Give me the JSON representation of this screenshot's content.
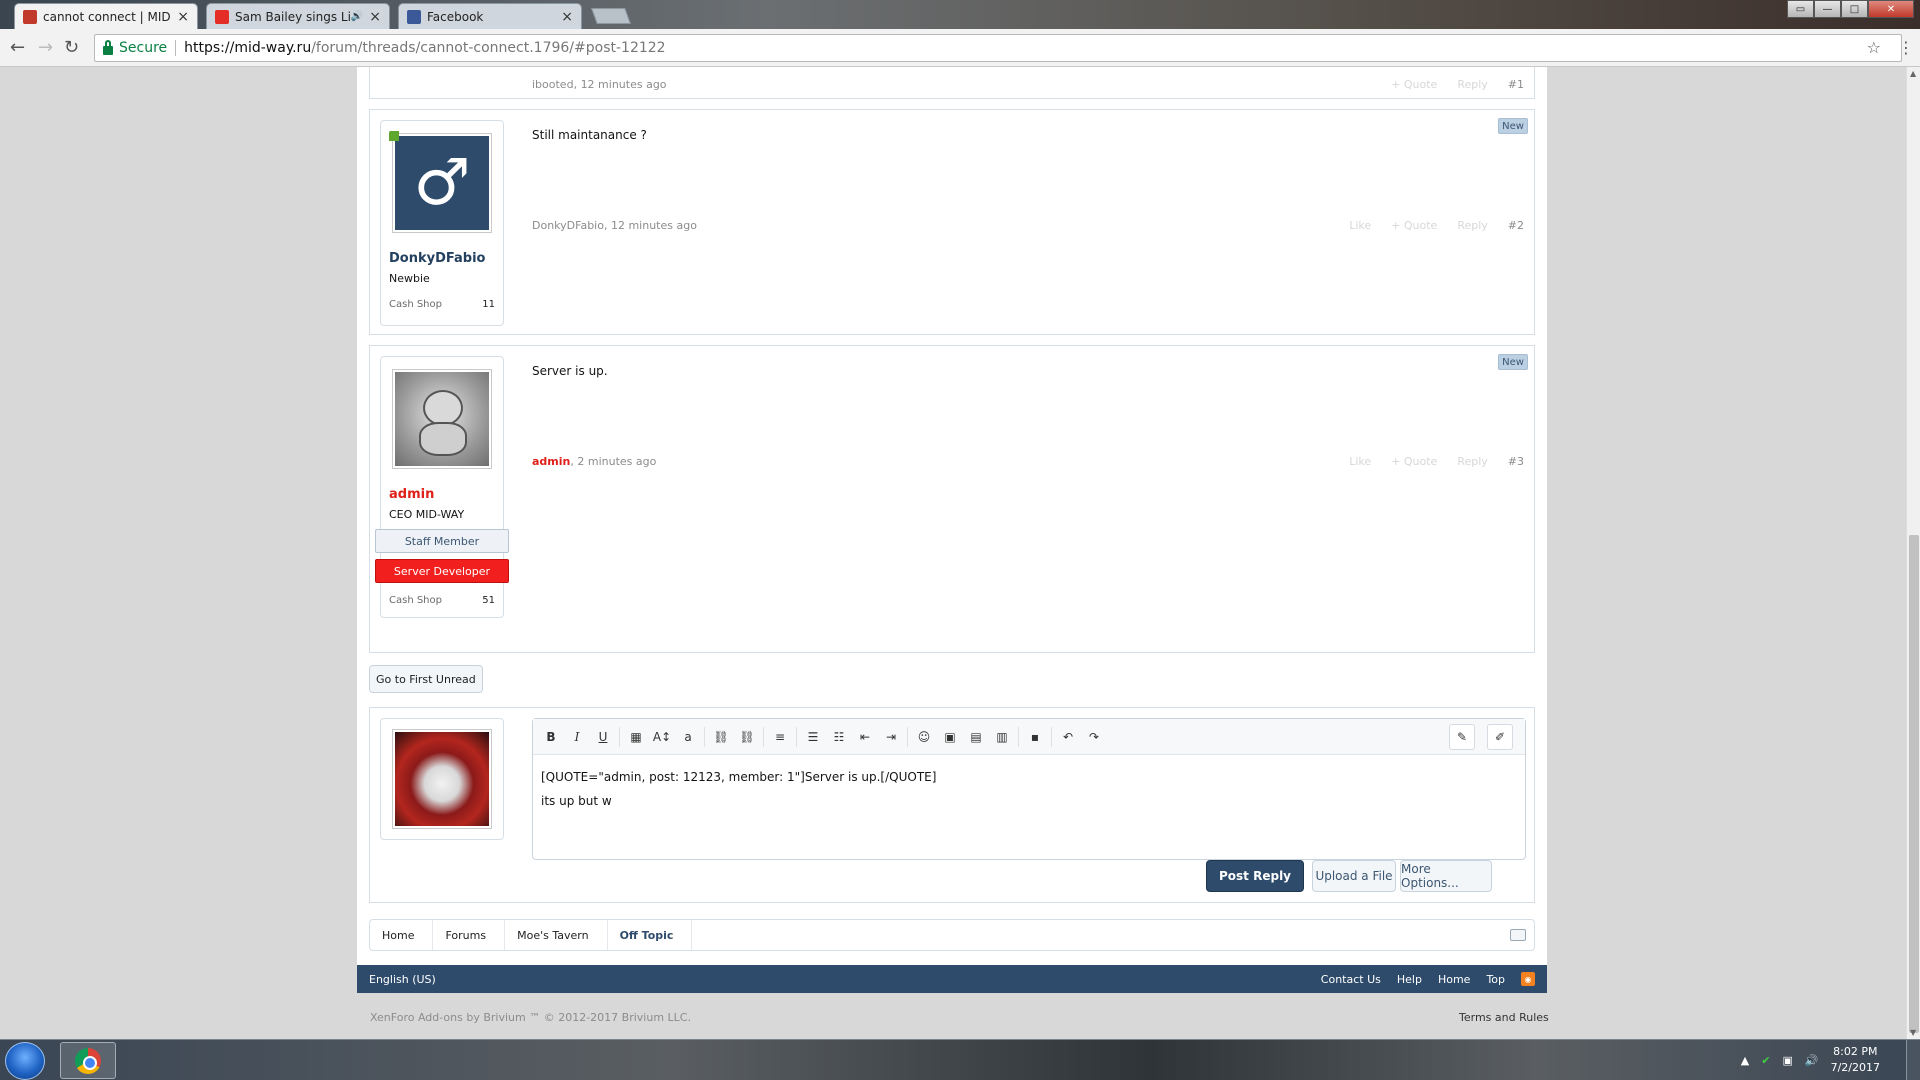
{
  "browser": {
    "tabs": [
      {
        "label": "cannot connect | MID-W",
        "favicon_color": "#c0392b",
        "active": true,
        "close": "×"
      },
      {
        "label": "Sam Bailey sings Liste",
        "favicon_color": "#e52d27",
        "active": false,
        "close": "×",
        "audio": "🔊"
      },
      {
        "label": "Facebook",
        "favicon_color": "#3b5998",
        "active": false,
        "close": "×"
      }
    ],
    "window_buttons": {
      "minimize": "—",
      "maximize": "□",
      "close": "✕"
    },
    "nav": {
      "back": "←",
      "forward": "→",
      "reload": "↻"
    },
    "secure_label": "Secure",
    "url_host": "https://mid-way.ru",
    "url_path": "/forum/threads/cannot-connect.1796/#post-12122",
    "star": "☆",
    "menu": "⋮"
  },
  "posts": [
    {
      "author": "ibooted",
      "time": "12 minutes ago",
      "actions": {
        "quote": "+ Quote",
        "reply": "Reply"
      },
      "number": "#1"
    },
    {
      "message": "Still maintanance ?",
      "new_label": "New",
      "user": {
        "name": "DonkyDFabio",
        "title": "Newbie",
        "stat_label": "Cash Shop",
        "stat_value": "11",
        "avatar_icon": "♂"
      },
      "author": "DonkyDFabio",
      "time": "12 minutes ago",
      "actions": {
        "like": "Like",
        "quote": "+ Quote",
        "reply": "Reply"
      },
      "number": "#2"
    },
    {
      "message": "Server is up.",
      "new_label": "New",
      "user": {
        "name": "admin",
        "title": "CEO MID-WAY",
        "badge1": "Staff Member",
        "badge2": "Server Developer",
        "stat_label": "Cash Shop",
        "stat_value": "51"
      },
      "author": "admin",
      "time": "2 minutes ago",
      "actions": {
        "like": "Like",
        "quote": "+ Quote",
        "reply": "Reply"
      },
      "number": "#3"
    }
  ],
  "go_first_unread": "Go to First Unread",
  "editor": {
    "line1": "[QUOTE=\"admin, post: 12123, member: 1\"]Server is up.[/QUOTE]",
    "line2": "its up but w",
    "tools": [
      "B",
      "I",
      "U"
    ]
  },
  "buttons": {
    "post_reply": "Post Reply",
    "upload": "Upload a File",
    "more": "More Options..."
  },
  "breadcrumb": [
    "Home",
    "Forums",
    "Moe's Tavern",
    "Off Topic"
  ],
  "footer": {
    "language": "English (US)",
    "links": [
      "Contact Us",
      "Help",
      "Home",
      "Top"
    ],
    "copyright": "XenForo Add-ons by Brivium ™ © 2012-2017 Brivium LLC.",
    "terms": "Terms and Rules"
  },
  "taskbar": {
    "time": "8:02 PM",
    "date": "7/2/2017"
  }
}
